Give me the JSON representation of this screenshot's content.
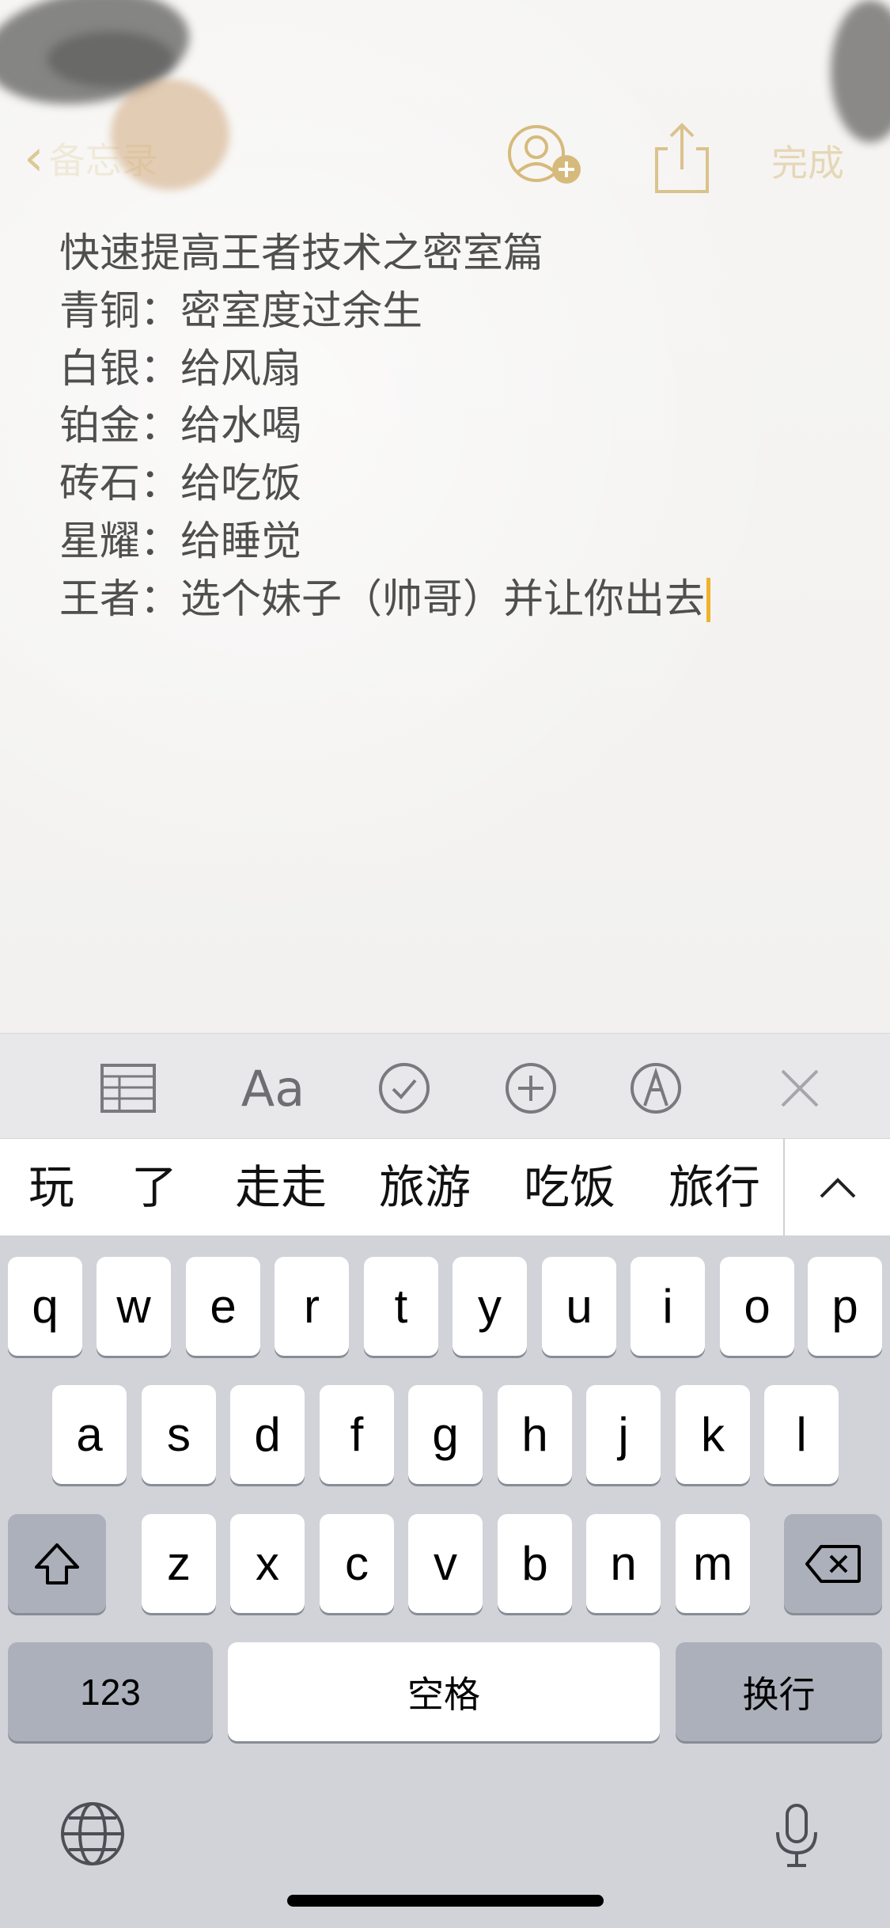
{
  "nav": {
    "back_label": "备忘录",
    "done_label": "完成"
  },
  "note": {
    "title": "快速提高王者技术之密室篇",
    "lines": [
      {
        "rank": "青铜：",
        "text": "密室度过余生"
      },
      {
        "rank": "白银：",
        "text": "给风扇"
      },
      {
        "rank": "铂金：",
        "text": "给水喝"
      },
      {
        "rank": "砖石：",
        "text": "给吃饭"
      },
      {
        "rank": "星耀：",
        "text": "给睡觉"
      },
      {
        "rank": "王者：",
        "text": "选个妹子（帅哥）并让你出去"
      }
    ]
  },
  "format_toolbar": {
    "font_label": "Aa"
  },
  "candidates": [
    "玩",
    "了",
    "走走",
    "旅游",
    "吃饭",
    "旅行"
  ],
  "keyboard": {
    "row1": [
      "q",
      "w",
      "e",
      "r",
      "t",
      "y",
      "u",
      "i",
      "o",
      "p"
    ],
    "row2": [
      "a",
      "s",
      "d",
      "f",
      "g",
      "h",
      "j",
      "k",
      "l"
    ],
    "row3": [
      "z",
      "x",
      "c",
      "v",
      "b",
      "n",
      "m"
    ],
    "numbers_label": "123",
    "space_label": "空格",
    "return_label": "换行"
  },
  "colors": {
    "accent": "#c9a24a",
    "cursor": "#f0b22a",
    "keyboard_bg": "#d1d3d9",
    "key_dark": "#abb0ba"
  }
}
